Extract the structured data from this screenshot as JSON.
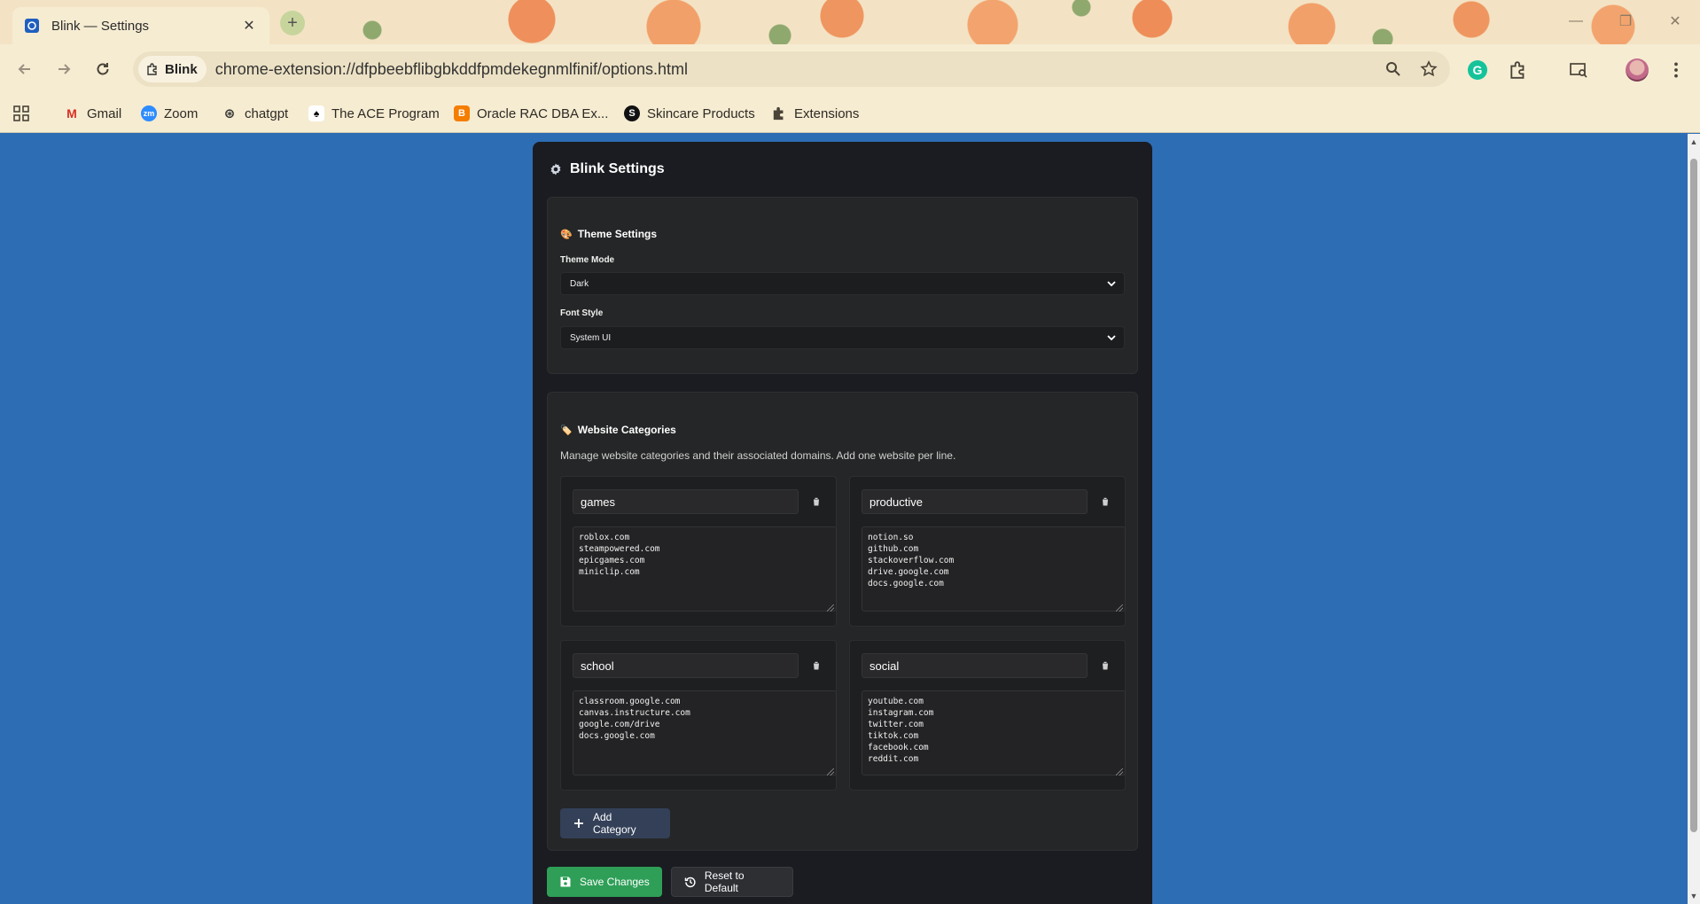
{
  "browser": {
    "tab_title": "Blink — Settings",
    "site_chip": "Blink",
    "url": "chrome-extension://dfpbeebflibgbkddfpmdekegnmlfinif/options.html",
    "bookmarks": [
      {
        "label": "Gmail",
        "icon": "gmail-icon"
      },
      {
        "label": "Zoom",
        "icon": "zoom-icon"
      },
      {
        "label": "chatgpt",
        "icon": "chatgpt-icon"
      },
      {
        "label": "The ACE Program",
        "icon": "ace-icon"
      },
      {
        "label": "Oracle RAC DBA Ex...",
        "icon": "blogger-icon"
      },
      {
        "label": "Skincare Products",
        "icon": "skincare-icon"
      },
      {
        "label": "Extensions",
        "icon": "puzzle-icon"
      }
    ]
  },
  "page": {
    "title": "Blink Settings",
    "theme": {
      "heading": "Theme Settings",
      "mode_label": "Theme Mode",
      "mode_value": "Dark",
      "font_label": "Font Style",
      "font_value": "System UI"
    },
    "categories": {
      "heading": "Website Categories",
      "description": "Manage website categories and their associated domains. Add one website per line.",
      "items": [
        {
          "name": "games",
          "sites": "roblox.com\nsteampowered.com\nepicgames.com\nminiclip.com"
        },
        {
          "name": "productive",
          "sites": "notion.so\ngithub.com\nstackoverflow.com\ndrive.google.com\ndocs.google.com"
        },
        {
          "name": "school",
          "sites": "classroom.google.com\ncanvas.instructure.com\ngoogle.com/drive\ndocs.google.com"
        },
        {
          "name": "social",
          "sites": "youtube.com\ninstagram.com\ntwitter.com\ntiktok.com\nfacebook.com\nreddit.com"
        }
      ],
      "add_label": "Add Category"
    },
    "actions": {
      "save_label": "Save Changes",
      "reset_label": "Reset to Default"
    }
  },
  "colors": {
    "page_bg": "#2d6db4",
    "panel_bg": "#1a1c21",
    "save_green": "#2f9f58",
    "add_blue": "#334058"
  }
}
